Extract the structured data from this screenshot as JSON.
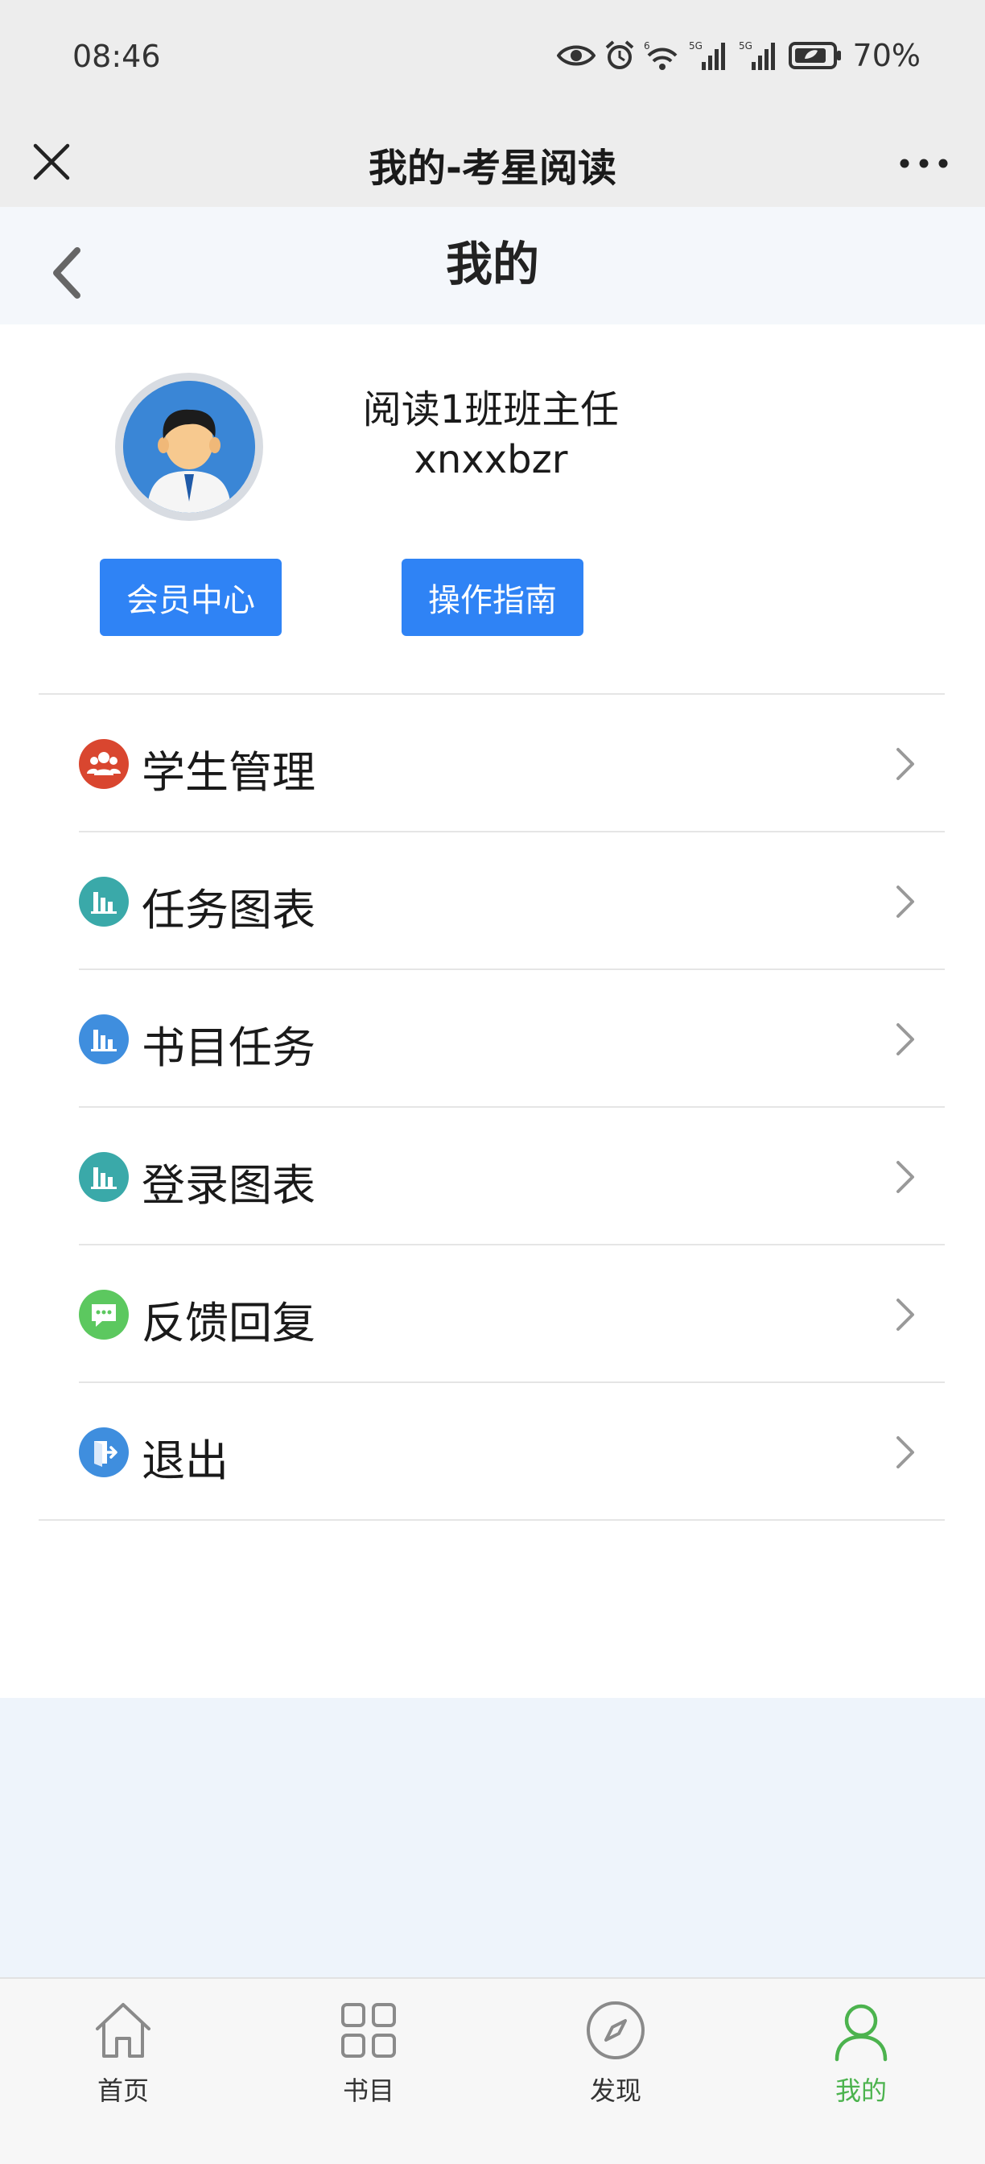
{
  "status_bar": {
    "time": "08:46",
    "battery": "70%",
    "net_label_1": "6",
    "net_label_2": "5G",
    "net_label_3": "5G"
  },
  "title_bar": {
    "title": "我的-考星阅读"
  },
  "page_header": {
    "title": "我的"
  },
  "profile": {
    "name": "阅读1班班主任",
    "username": "xnxxbzr",
    "member_button": "会员中心",
    "guide_button": "操作指南"
  },
  "menu": [
    {
      "label": "学生管理",
      "icon": "group-icon",
      "color": "#d9462f"
    },
    {
      "label": "任务图表",
      "icon": "bar-chart-icon",
      "color": "#3aa9a9"
    },
    {
      "label": "书目任务",
      "icon": "bar-chart-icon",
      "color": "#3f8ede"
    },
    {
      "label": "登录图表",
      "icon": "bar-chart-icon",
      "color": "#3aa9a9"
    },
    {
      "label": "反馈回复",
      "icon": "message-icon",
      "color": "#5cc85f"
    },
    {
      "label": "退出",
      "icon": "exit-icon",
      "color": "#3f8ede"
    }
  ],
  "tab_bar": {
    "tabs": [
      {
        "label": "首页",
        "icon": "home-icon"
      },
      {
        "label": "书目",
        "icon": "grid-icon"
      },
      {
        "label": "发现",
        "icon": "compass-icon"
      },
      {
        "label": "我的",
        "icon": "person-icon",
        "active": true
      }
    ],
    "active_color": "#4cb34e"
  },
  "colors": {
    "primary_button": "#2f83f5",
    "background": "#eef4fb"
  }
}
